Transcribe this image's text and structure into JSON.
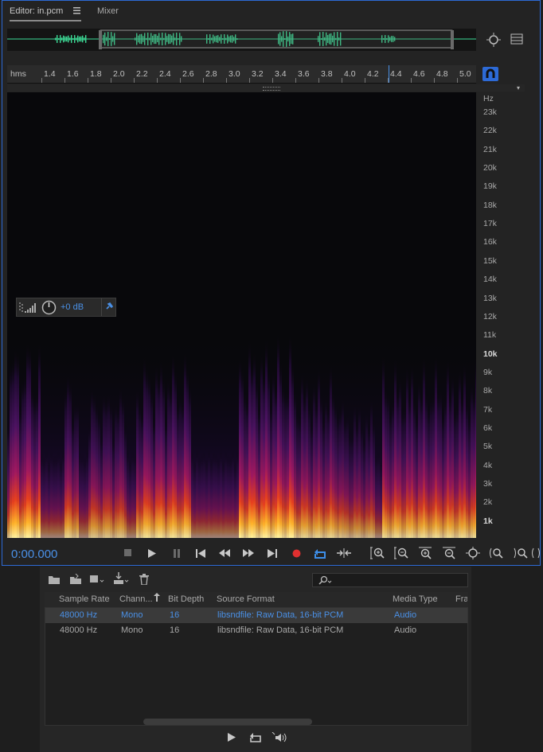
{
  "tabs": {
    "editor_label": "Editor: in.pcm",
    "mixer_label": "Mixer"
  },
  "ruler": {
    "unit_label": "hms",
    "ticks": [
      "1.4",
      "1.6",
      "1.8",
      "2.0",
      "2.2",
      "2.4",
      "2.6",
      "2.8",
      "3.0",
      "3.2",
      "3.4",
      "3.6",
      "3.8",
      "4.0",
      "4.2",
      "4.4",
      "4.6",
      "4.8",
      "5.0"
    ]
  },
  "hz_axis": {
    "unit_label": "Hz",
    "labels": [
      "23k",
      "22k",
      "21k",
      "20k",
      "19k",
      "18k",
      "17k",
      "16k",
      "15k",
      "14k",
      "13k",
      "12k",
      "11k",
      "10k",
      "9k",
      "8k",
      "7k",
      "6k",
      "5k",
      "4k",
      "3k",
      "2k",
      "1k"
    ]
  },
  "hud": {
    "gain_label": "+0 dB"
  },
  "transport": {
    "time": "0:00.000",
    "buttons": [
      "stop-icon",
      "play-icon",
      "pause-icon",
      "skip-start-icon",
      "rewind-icon",
      "fast-forward-icon",
      "skip-end-icon",
      "record-icon",
      "loop-icon",
      "skip-selection-icon"
    ]
  },
  "files_table": {
    "columns": [
      "Sample Rate",
      "Chann...",
      "Bit Depth",
      "Source Format",
      "Media Type",
      "Fra"
    ],
    "rows": [
      {
        "sample_rate": "48000 Hz",
        "channels": "Mono",
        "bit_depth": "16",
        "source_format": "libsndfile: Raw Data, 16-bit PCM",
        "media_type": "Audio",
        "selected": true
      },
      {
        "sample_rate": "48000 Hz",
        "channels": "Mono",
        "bit_depth": "16",
        "source_format": "libsndfile: Raw Data, 16-bit PCM",
        "media_type": "Audio",
        "selected": false
      }
    ]
  },
  "colors": {
    "accent": "#2d6ad6",
    "waveform": "#3ddc97",
    "time": "#4a90e6",
    "record": "#e03030"
  }
}
